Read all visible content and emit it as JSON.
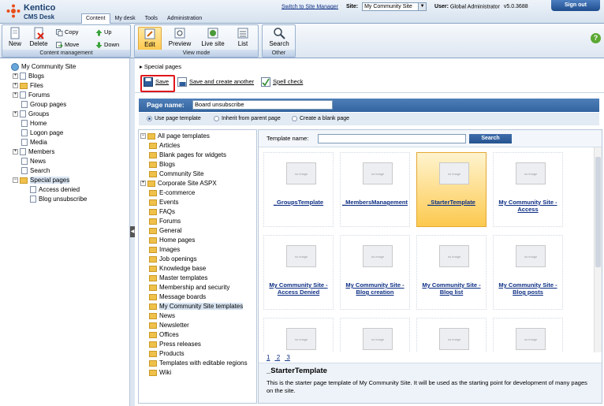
{
  "brand": {
    "name": "Kentico",
    "product": "CMS Desk"
  },
  "header": {
    "tabs": [
      "Content",
      "My desk",
      "Tools",
      "Administration"
    ],
    "active_tab": "Content",
    "switch_link": "Switch to Site Manager",
    "site_label": "Site:",
    "site_value": "My Community Site",
    "user_label": "User:",
    "user_value": "Global Administrator",
    "version": "v5.0.3688",
    "signout": "Sign out"
  },
  "ribbon": {
    "content_management": {
      "caption": "Content management",
      "new": "New",
      "delete": "Delete",
      "copy": "Copy",
      "move": "Move",
      "up": "Up",
      "down": "Down"
    },
    "view_mode": {
      "caption": "View mode",
      "edit": "Edit",
      "preview": "Preview",
      "live_site": "Live site",
      "list": "List"
    },
    "other": {
      "caption": "Other",
      "search": "Search"
    }
  },
  "tree": {
    "root": "My Community Site",
    "items": [
      "Blogs",
      "Files",
      "Forums",
      "Group pages",
      "Groups",
      "Home",
      "Logon page",
      "Media",
      "Members",
      "News",
      "Search",
      "Special pages"
    ],
    "children": [
      "Access denied",
      "Blog unsubscribe"
    ]
  },
  "main": {
    "breadcrumb": "Special pages",
    "toolbar": {
      "save": "Save",
      "save_create": "Save and create another",
      "spell": "Spell check"
    },
    "page_name_label": "Page name:",
    "page_name_value": "Board unsubscribe",
    "radios": [
      "Use page template",
      "Inherit from parent page",
      "Create a blank page"
    ],
    "categories": {
      "root": "All page templates",
      "items": [
        "Articles",
        "Blank pages for widgets",
        "Blogs",
        "Community Site",
        "Corporate Site ASPX",
        "E-commerce",
        "Events",
        "FAQs",
        "Forums",
        "General",
        "Home pages",
        "Images",
        "Job openings",
        "Knowledge base",
        "Master templates",
        "Membership and security",
        "Message boards",
        "My Community Site templates",
        "News",
        "Newsletter",
        "Offices",
        "Press releases",
        "Products",
        "Templates with editable regions",
        "Wiki"
      ]
    },
    "template_search": {
      "label": "Template name:",
      "button": "Search"
    },
    "thumb_text": "no image",
    "templates": [
      "_GroupsTemplate",
      "_MembersManagement",
      "_StarterTemplate",
      "My Community Site - Access",
      "My Community Site - Access Denied",
      "My Community Site - Blog creation",
      "My Community Site - Blog list",
      "My Community Site - Blog posts",
      "",
      "",
      "",
      ""
    ],
    "pages": [
      "1",
      "2",
      "3"
    ],
    "selected": {
      "title": "_StarterTemplate",
      "description": "This is the starter page template of My Community Site. It will be used as the starting point for development of many pages on the site."
    }
  }
}
